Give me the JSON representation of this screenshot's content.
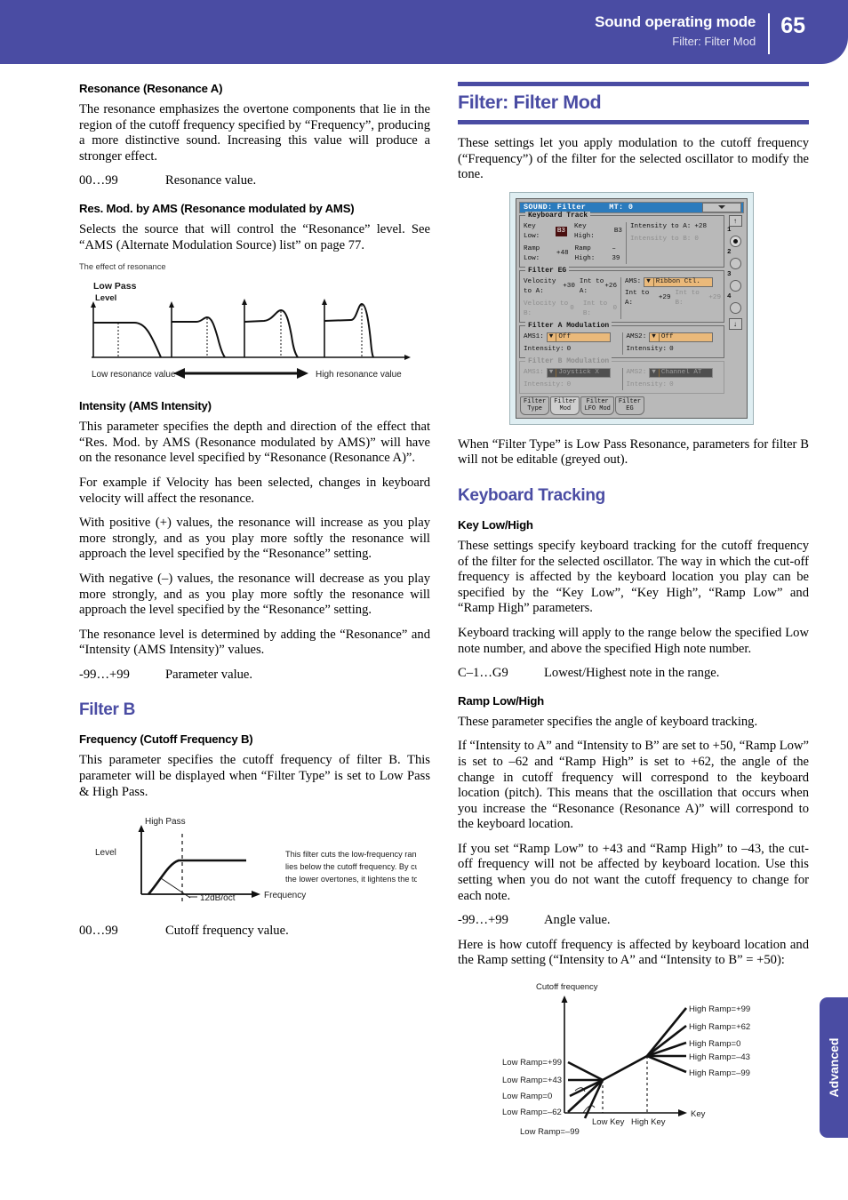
{
  "header": {
    "title": "Sound operating mode",
    "subtitle": "Filter: Filter Mod",
    "page_number": "65",
    "accent_color": "#4a4ca3"
  },
  "side_tab": {
    "label": "Advanced"
  },
  "left_column": {
    "h_resonance": "Resonance (Resonance A)",
    "p_resonance": "The resonance emphasizes the overtone components that lie in the region of the cutoff frequency specified by “Frequency”, producing a more distinctive sound. Increasing this value will produce a stronger effect.",
    "val_resonance_key": "00…99",
    "val_resonance_desc": "Resonance value.",
    "h_resmod": "Res. Mod. by AMS (Resonance modulated by AMS)",
    "p_resmod": "Selects the source that will control the “Resonance” level. See “AMS (Alternate Modulation Source) list” on page 77.",
    "fig_resonance": {
      "caption": "The effect of resonance",
      "label_lowpass": "Low Pass",
      "label_level": "Level",
      "label_low": "Low resonance value",
      "label_high": "High resonance value"
    },
    "h_intensity": "Intensity (AMS Intensity)",
    "p_intensity_1": "This parameter specifies the depth and direction of the effect that “Res. Mod. by AMS (Resonance modulated by AMS)” will have on the resonance level specified by “Resonance (Resonance A)”.",
    "p_intensity_2": "For example if Velocity has been selected, changes in keyboard velocity will affect the resonance.",
    "p_intensity_3": "With positive (+) values, the resonance will increase as you play more strongly, and as you play more softly the resonance will approach the level specified by the “Resonance” setting.",
    "p_intensity_4": "With negative (–) values, the resonance will decrease as you play more strongly, and as you play more softly the resonance will approach the level specified by the “Resonance” setting.",
    "p_intensity_5": "The resonance level is determined by adding the “Resonance” and “Intensity (AMS Intensity)” values.",
    "val_param_key": "-99…+99",
    "val_param_desc": "Parameter value.",
    "h_filter_b": "Filter B",
    "h_frequency_b": "Frequency (Cutoff Frequency B)",
    "p_frequency_b": "This parameter specifies the cutoff frequency of filter B. This parameter will be displayed when “Filter Type” is set to Low Pass & High Pass.",
    "fig_highpass": {
      "label_highpass": "High Pass",
      "label_level": "Level",
      "label_slope": "12dB/oct",
      "label_frequency": "Frequency",
      "note_line1": "This filter cuts the low-frequency range that",
      "note_line2": "lies below the cutoff frequency. By cutting",
      "note_line3": "the lower overtones, it lightens the tone."
    },
    "val_cutoff_key": "00…99",
    "val_cutoff_desc": "Cutoff frequency value."
  },
  "right_column": {
    "chapter_title": "Filter: Filter Mod",
    "p_intro": "These settings let you apply modulation to the cutoff frequency (“Frequency”) of the filter for the selected oscillator to modify the tone.",
    "p_after_lcd": "When “Filter Type” is Low Pass Resonance, parameters for filter B will not be editable (greyed out).",
    "h_keyboard_tracking": "Keyboard Tracking",
    "h_key_lowhigh": "Key Low/High",
    "p_key_1": "These settings specify keyboard tracking for the cutoff frequency of the filter for the selected oscillator. The way in which the cut-off frequency is affected by the keyboard location you play can be specified by the “Key Low”, “Key High”, “Ramp Low” and “Ramp High” parameters.",
    "p_key_2": "Keyboard tracking will apply to the range below the specified Low note number, and above the specified High note number.",
    "val_note_key": "C–1…G9",
    "val_note_desc": "Lowest/Highest note in the range.",
    "h_ramp_lowhigh": "Ramp Low/High",
    "p_ramp_1": "These parameter specifies the angle of keyboard tracking.",
    "p_ramp_2": "If “Intensity to A” and “Intensity to B” are set to +50, “Ramp Low” is set to –62 and “Ramp High” is set to +62, the angle of the change in cutoff frequency will correspond to the keyboard location (pitch). This means that the oscillation that occurs when you increase the “Resonance (Resonance A)” will correspond to the keyboard location.",
    "p_ramp_3": "If you set “Ramp Low” to +43 and “Ramp High” to –43, the cut-off frequency will not be affected by keyboard location. Use this setting when you do not want the cutoff frequency to change for each note.",
    "val_angle_key": "-99…+99",
    "val_angle_desc": "Angle value.",
    "p_ramp_4": "Here is how cutoff frequency is affected by keyboard location and the Ramp setting (“Intensity to A” and “Intensity to B” = +50):",
    "fig_ramp": {
      "y_label": "Cutoff frequency",
      "x_label": "Key",
      "low_key": "Low Key",
      "high_key": "High Key",
      "low_labels": [
        "Low Ramp=+99",
        "Low Ramp=+43",
        "Low Ramp=0",
        "Low Ramp=–62",
        "Low Ramp=–99"
      ],
      "high_labels": [
        "High Ramp=+99",
        "High Ramp=+62",
        "High Ramp=0",
        "High Ramp=–43",
        "High Ramp=–99"
      ]
    }
  },
  "lcd": {
    "titlebar": {
      "mode": "SOUND: Filter",
      "mt": "MT: 0"
    },
    "keyboard_track": {
      "group_label": "Keyboard Track",
      "key_low_label": "Key Low:",
      "key_low_value": "B3",
      "key_high_label": "Key High:",
      "key_high_value": "B3",
      "ramp_low_label": "Ramp Low:",
      "ramp_low_value": "+48",
      "ramp_high_label": "Ramp High:",
      "ramp_high_value": "–39",
      "intensity_a_label": "Intensity to A:",
      "intensity_a_value": "+28",
      "intensity_b_label": "Intensity to B:",
      "intensity_b_value": "0"
    },
    "filter_eg": {
      "group_label": "Filter EG",
      "velocity_a_label": "Velocity to A:",
      "velocity_a_value": "+30",
      "int_a_label": "Int to A:",
      "int_a_value": "+26",
      "velocity_b_label": "Velocity to B:",
      "velocity_b_value": "0",
      "int_b_label": "Int to B:",
      "int_b_value": "0",
      "ams_label": "AMS:",
      "ams_value": "Ribbon Ctl.",
      "int_to_a_label": "Int to A:",
      "int_to_a_value": "+29",
      "int_to_b_label": "Int to B:",
      "int_to_b_value": "+29"
    },
    "filter_a_mod": {
      "group_label": "Filter A Modulation",
      "ams1_label": "AMS1:",
      "ams1_value": "Off",
      "ams1_intensity_label": "Intensity:",
      "ams1_intensity_value": "0",
      "ams2_label": "AMS2:",
      "ams2_value": "Off",
      "ams2_intensity_label": "Intensity:",
      "ams2_intensity_value": "0"
    },
    "filter_b_mod": {
      "group_label": "Filter B Modulation",
      "ams1_label": "AMS1:",
      "ams1_value": "Joystick X",
      "ams1_intensity_label": "Intensity:",
      "ams1_intensity_value": "0",
      "ams2_label": "AMS2:",
      "ams2_value": "Channel AT",
      "ams2_intensity_label": "Intensity:",
      "ams2_intensity_value": "0"
    },
    "tabs": [
      {
        "line1": "Filter",
        "line2": "Type",
        "active": false
      },
      {
        "line1": "Filter",
        "line2": "Mod",
        "active": true
      },
      {
        "line1": "Filter",
        "line2": "LFO Mod",
        "active": false
      },
      {
        "line1": "Filter",
        "line2": "EG",
        "active": false
      }
    ],
    "rail": {
      "up": "↑",
      "down": "↓",
      "numbers": [
        "1",
        "2",
        "3",
        "4"
      ]
    }
  }
}
